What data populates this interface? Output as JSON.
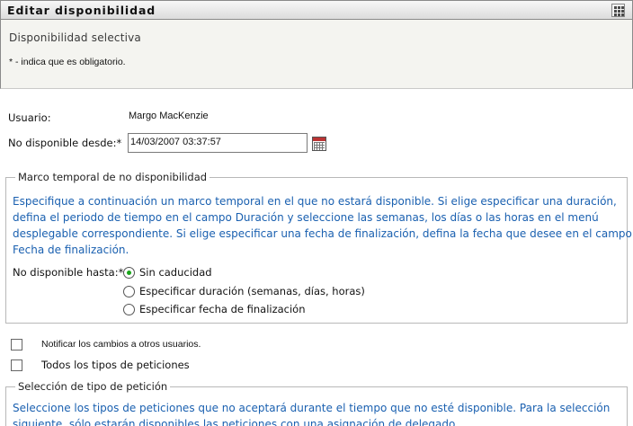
{
  "header": {
    "title": "Editar disponibilidad",
    "subtitle": "Disponibilidad selectiva",
    "required_note": "* - indica que es obligatorio."
  },
  "form": {
    "user_label": "Usuario:",
    "user_value": "Margo MacKenzie",
    "unavailable_from_label": "No disponible desde:*",
    "unavailable_from_value": "14/03/2007 03:37:57",
    "calendar_icon": "calendar-icon"
  },
  "timeframe": {
    "legend": "Marco temporal de no disponibilidad",
    "info_lines": [
      "Especifique a continuación un marco temporal en el que no estará disponible. Si elige especificar una duración,",
      "defina el periodo de tiempo en el campo Duración y seleccione las semanas, los días o las horas en el menú",
      "desplegable correspondiente. Si elige especificar una fecha de finalización, defina la fecha que desee en el campo",
      "Fecha de finalización."
    ],
    "until_label": "No disponible hasta:*",
    "options": [
      {
        "label": "Sin caducidad",
        "selected": true
      },
      {
        "label": "Especificar duración (semanas, días, horas)",
        "selected": false
      },
      {
        "label": "Especificar fecha de finalización",
        "selected": false
      }
    ]
  },
  "checkboxes": {
    "notify_label": "Notificar los cambios a otros usuarios.",
    "all_types_label": "Todos los tipos de peticiones"
  },
  "request_type": {
    "legend": "Selección de tipo de petición",
    "info_lines": [
      "Seleccione los tipos de peticiones que no aceptará durante el tiempo que no esté disponible. Para la selección",
      "siguiente, sólo estarán disponibles las peticiones con una asignación de delegado."
    ]
  },
  "colors": {
    "info_text": "#1a60b0",
    "radio_selected": "#1aa61a"
  }
}
